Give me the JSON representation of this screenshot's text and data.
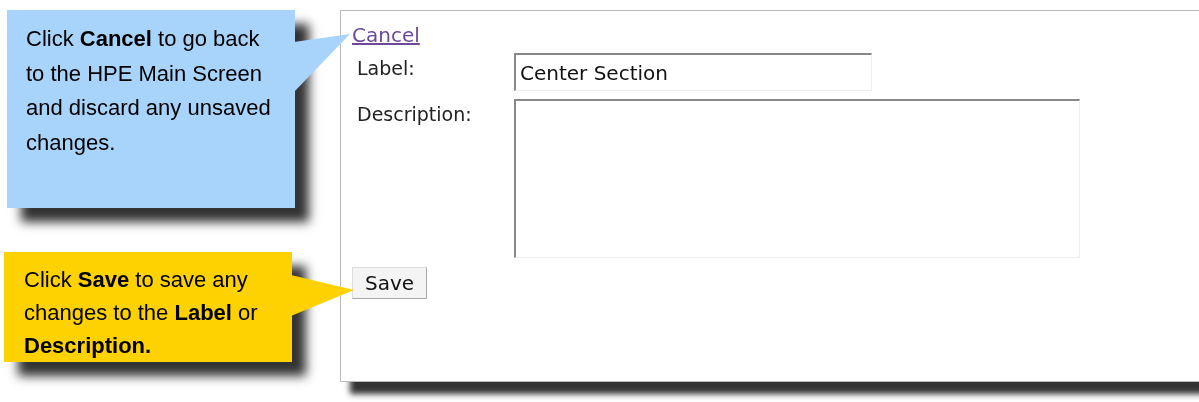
{
  "callouts": [
    {
      "text": "Click **Cancel** to go back to the HPE Main Screen and discard any unsaved changes.",
      "color": "#a8d4fb"
    },
    {
      "text": "Click **Save** to save any changes to the **Label** or **Description.**",
      "color": "#fed100"
    }
  ],
  "form": {
    "cancel_link": "Cancel",
    "fields": [
      {
        "kind": "input",
        "label": "Label:",
        "value": "Center Section"
      },
      {
        "kind": "textarea",
        "label": "Description:"
      }
    ],
    "save_button": "Save"
  }
}
